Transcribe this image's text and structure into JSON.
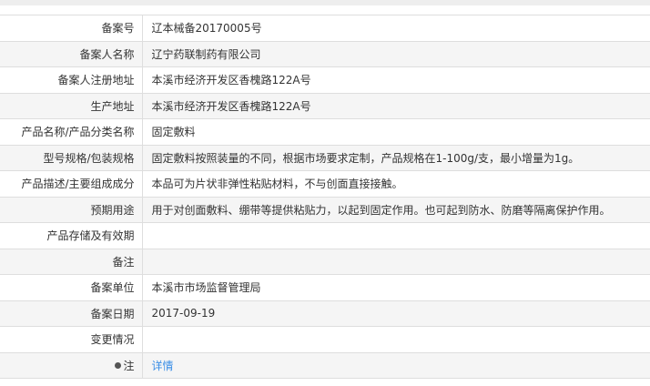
{
  "rows": [
    {
      "label": "备案号",
      "value": "辽本械备20170005号"
    },
    {
      "label": "备案人名称",
      "value": "辽宁药联制药有限公司"
    },
    {
      "label": "备案人注册地址",
      "value": "本溪市经济开发区香槐路122A号"
    },
    {
      "label": "生产地址",
      "value": "本溪市经济开发区香槐路122A号"
    },
    {
      "label": "产品名称/产品分类名称",
      "value": "固定敷料"
    },
    {
      "label": "型号规格/包装规格",
      "value": "固定敷料按照装量的不同，根据市场要求定制，产品规格在1-100g/支，最小增量为1g。"
    },
    {
      "label": "产品描述/主要组成成分",
      "value": "本品可为片状非弹性粘贴材料，不与创面直接接触。"
    },
    {
      "label": "预期用途",
      "value": "用于对创面敷料、绷带等提供粘贴力，以起到固定作用。也可起到防水、防磨等隔离保护作用。"
    },
    {
      "label": "产品存储及有效期",
      "value": ""
    },
    {
      "label": "备注",
      "value": ""
    },
    {
      "label": "备案单位",
      "value": "本溪市市场监督管理局"
    },
    {
      "label": "备案日期",
      "value": "2017-09-19"
    },
    {
      "label": "变更情况",
      "value": ""
    }
  ],
  "note_row": {
    "label": "注",
    "icon": "note-bulb-icon",
    "link_text": "详情",
    "link_color": "#3a8ee6"
  }
}
